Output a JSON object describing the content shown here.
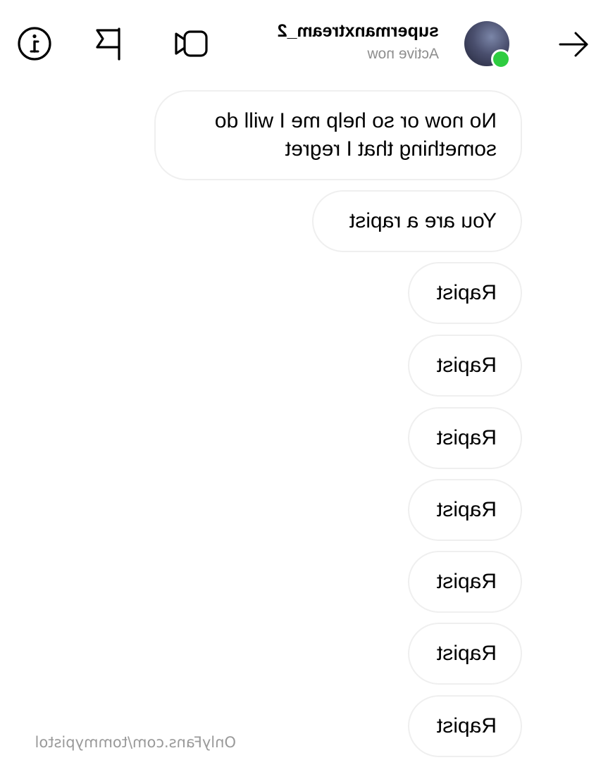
{
  "header": {
    "username": "supermanxtream_2",
    "status": "Active now",
    "icons": {
      "back": "arrow-left-icon",
      "video": "video-call-icon",
      "flag": "flag-icon",
      "info": "info-icon"
    },
    "online_color": "#2ecc40"
  },
  "messages": [
    {
      "text": "No now or so help me I will do\nsomething that I regret"
    },
    {
      "text": "You are a rapist"
    },
    {
      "text": "Rapist"
    },
    {
      "text": "Rapist"
    },
    {
      "text": "Rapist"
    },
    {
      "text": "Rapist"
    },
    {
      "text": "Rapist"
    },
    {
      "text": "Rapist"
    },
    {
      "text": "Rapist"
    }
  ],
  "watermark": "OnlyFans.com/tommypistol"
}
